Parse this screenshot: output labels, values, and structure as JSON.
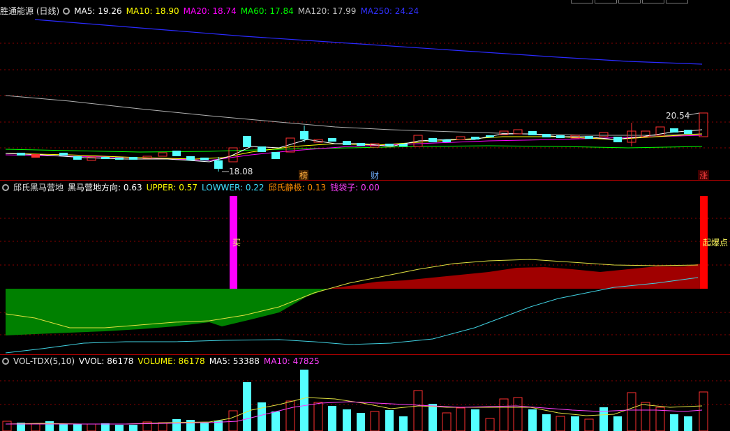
{
  "header": {
    "stock_title": "胜通能源 (日线)",
    "ma_labels": [
      {
        "text": "MA5: 19.26",
        "color": "#ffffff"
      },
      {
        "text": "MA10: 18.90",
        "color": "#ffff00"
      },
      {
        "text": "MA20: 18.74",
        "color": "#ff00ff"
      },
      {
        "text": "MA60: 17.84",
        "color": "#00ff00"
      },
      {
        "text": "MA120: 17.99",
        "color": "#c0c0c0"
      },
      {
        "text": "MA250: 24.24",
        "color": "#3030ff"
      }
    ]
  },
  "price_panel": {
    "high_label": "20.54",
    "low_label": "18.08",
    "markers": [
      "榜",
      "财",
      "涨"
    ]
  },
  "indicator_panel": {
    "title": "邱氏黑马营地",
    "labels": [
      {
        "text": "黑马营地方向: 0.63",
        "color": "#ffffff"
      },
      {
        "text": "UPPER: 0.57",
        "color": "#ffff00"
      },
      {
        "text": "LOWWER: 0.22",
        "color": "#40e0ff"
      },
      {
        "text": "邱氏静极: 0.13",
        "color": "#ff8c00"
      },
      {
        "text": "钱袋子: 0.00",
        "color": "#ff40ff"
      }
    ],
    "buy_label": "买",
    "breakout_label": "起爆点"
  },
  "volume_panel": {
    "title": "VOL-TDX(5,10)",
    "labels": [
      {
        "text": "VVOL: 86178",
        "color": "#ffffff"
      },
      {
        "text": "VOLUME: 86178",
        "color": "#ffff00"
      },
      {
        "text": "MA5: 53388",
        "color": "#ffffff"
      },
      {
        "text": "MA10: 47825",
        "color": "#ff40ff"
      }
    ]
  }
}
